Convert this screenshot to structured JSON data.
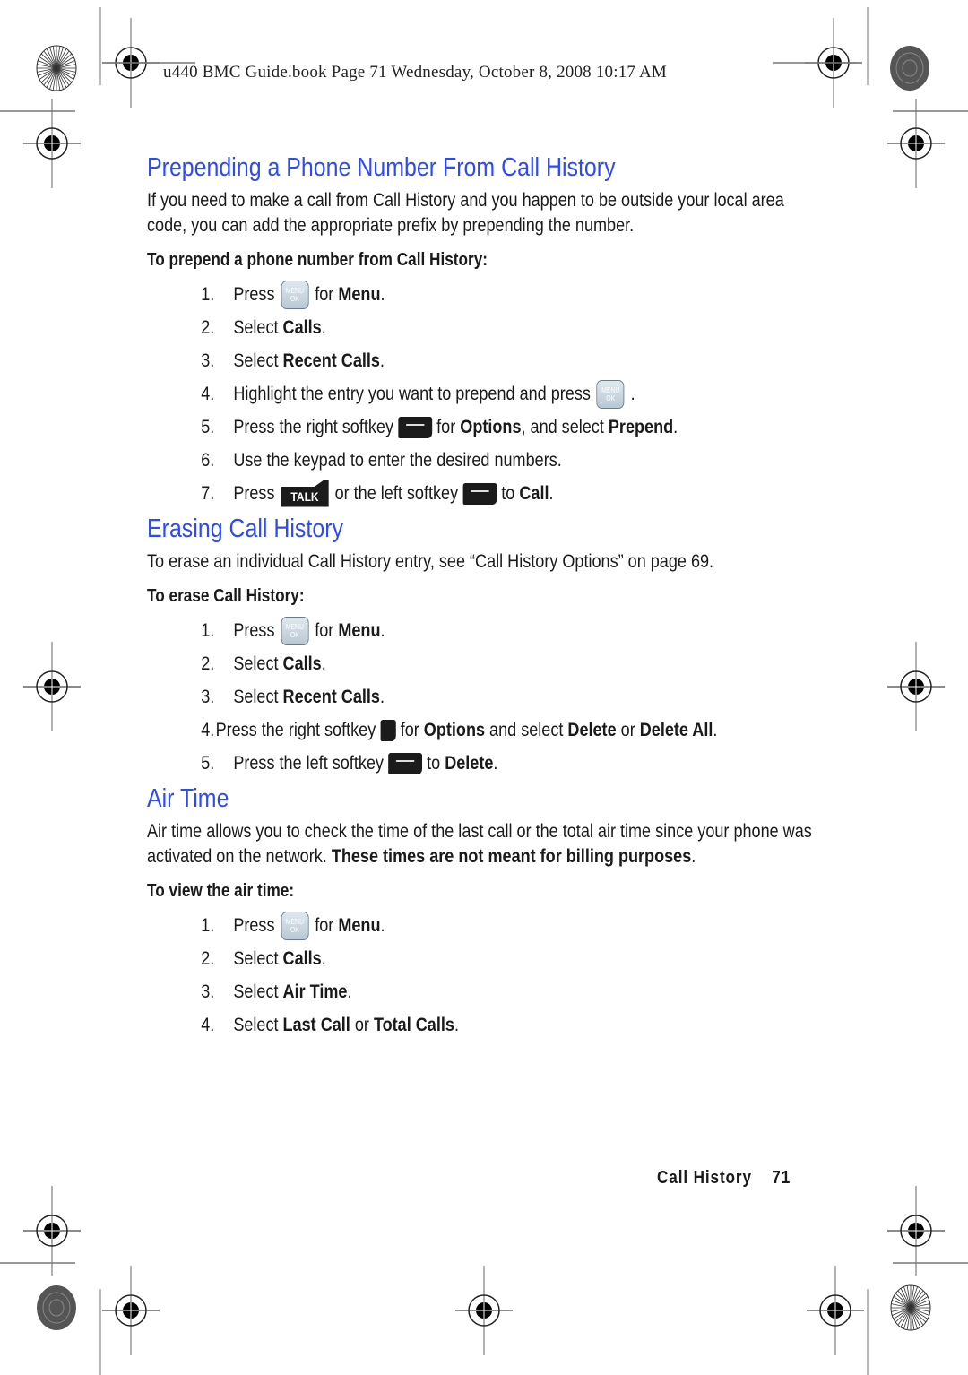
{
  "header": {
    "slug": "u440 BMC Guide.book  Page 71  Wednesday, October 8, 2008  10:17 AM"
  },
  "icons": {
    "menu_key_top": "MENU",
    "menu_key_bottom": "OK",
    "talk_key": "TALK"
  },
  "sections": [
    {
      "title": "Prepending a Phone Number From Call History",
      "intro": "If you need to make a call from Call History and you happen to be outside your local area code, you can add the appropriate prefix by prepending the number.",
      "procedure_title": "To prepend a phone number from Call History:",
      "steps": [
        {
          "n": "1.",
          "a": "Press",
          "b": "for",
          "c": "Menu",
          "d": "."
        },
        {
          "n": "2.",
          "a": "Select",
          "c": "Calls",
          "d": "."
        },
        {
          "n": "3.",
          "a": "Select",
          "c": "Recent Calls",
          "d": "."
        },
        {
          "n": "4.",
          "a": "Highlight the entry you want to prepend and press",
          "d": "."
        },
        {
          "n": "5.",
          "a": "Press the right softkey",
          "b": "for",
          "c": "Options",
          "e": ", and select",
          "f": "Prepend",
          "d": "."
        },
        {
          "n": "6.",
          "a": "Use the keypad to enter the desired numbers."
        },
        {
          "n": "7.",
          "a": "Press",
          "b": "or the left softkey",
          "e": "to",
          "c": "Call",
          "d": "."
        }
      ]
    },
    {
      "title": "Erasing Call History",
      "intro": "To erase an individual Call History entry, see “Call History Options” on page 69.",
      "procedure_title": "To erase Call History:",
      "steps": [
        {
          "n": "1.",
          "a": "Press",
          "b": "for",
          "c": "Menu",
          "d": "."
        },
        {
          "n": "2.",
          "a": "Select",
          "c": "Calls",
          "d": "."
        },
        {
          "n": "3.",
          "a": "Select",
          "c": "Recent Calls",
          "d": "."
        },
        {
          "n": "4.",
          "a": "Press the right softkey",
          "b": "for",
          "c": "Options",
          "e": "and select",
          "f": "Delete",
          "g": "or",
          "h": "Delete All",
          "d": "."
        },
        {
          "n": "5.",
          "a": "Press the left softkey",
          "b": "to",
          "c": "Delete",
          "d": "."
        }
      ]
    },
    {
      "title": "Air Time",
      "intro": "Air time allows you to check the time of the last call or the total air time since your phone was activated on the network.",
      "intro_bold": "These times are not meant for billing purposes",
      "intro_end": ".",
      "procedure_title": "To view the air time:",
      "steps": [
        {
          "n": "1.",
          "a": "Press",
          "b": "for",
          "c": "Menu",
          "d": "."
        },
        {
          "n": "2.",
          "a": "Select",
          "c": "Calls",
          "d": "."
        },
        {
          "n": "3.",
          "a": "Select",
          "c": "Air Time",
          "d": "."
        },
        {
          "n": "4.",
          "a": "Select",
          "c": "Last Call",
          "e": "or",
          "f": "Total Calls",
          "d": "."
        }
      ]
    }
  ],
  "footer": {
    "section": "Call History",
    "page": "71"
  },
  "colors": {
    "heading": "#2e4bf0"
  }
}
